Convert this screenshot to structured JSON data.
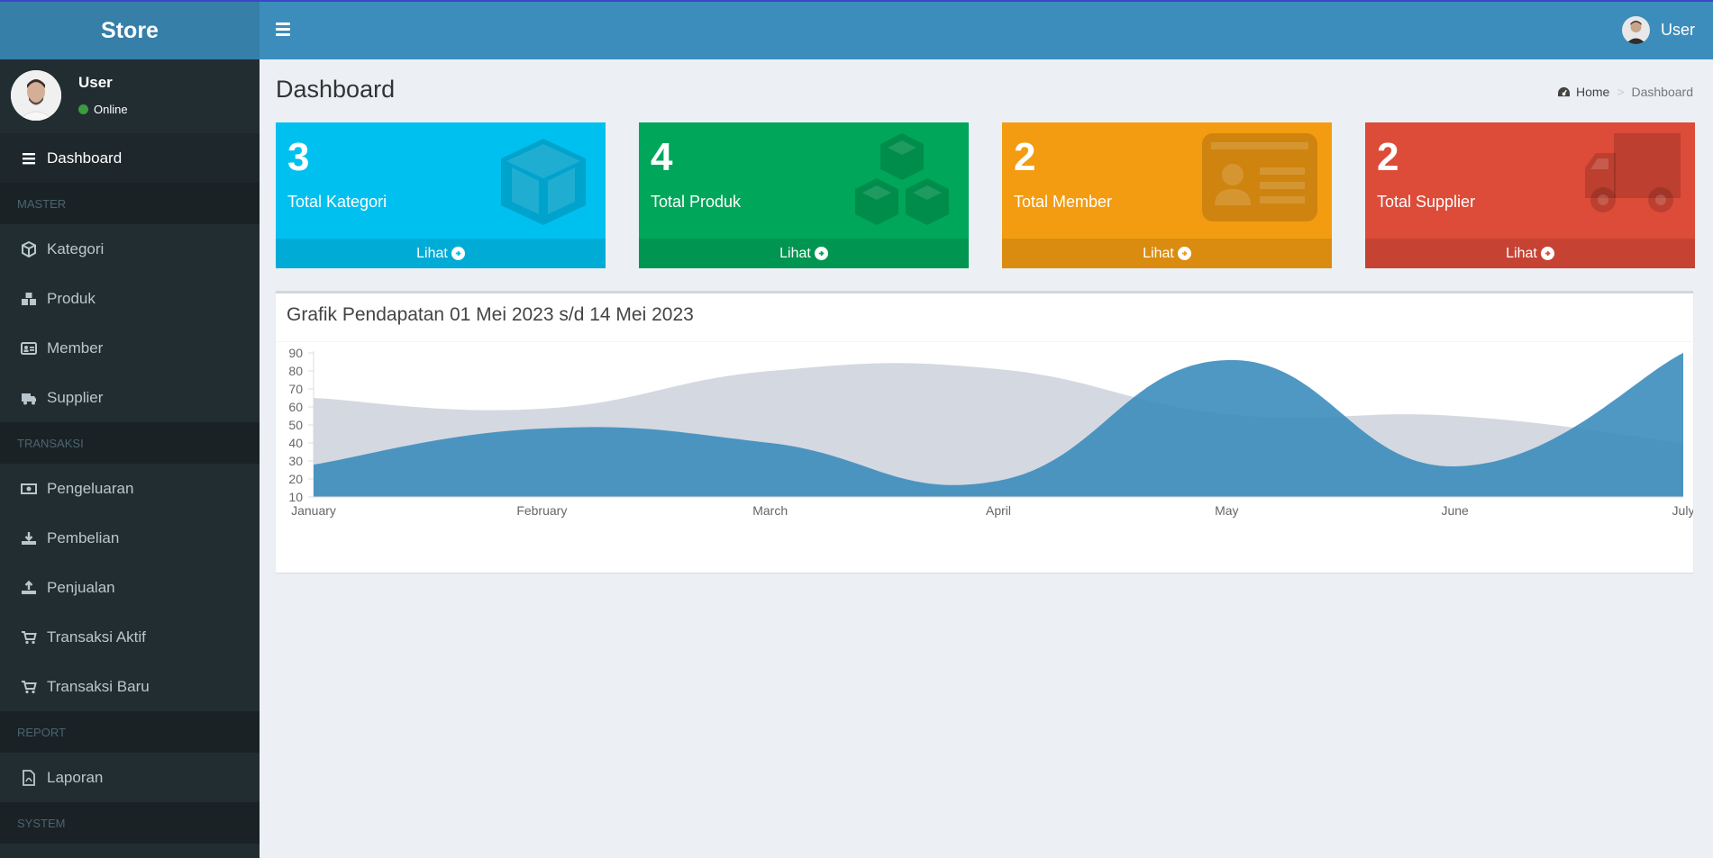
{
  "app": {
    "title": "Store"
  },
  "header": {
    "user_name": "User"
  },
  "sidebar": {
    "user": {
      "name": "User",
      "status": "Online"
    },
    "items": [
      {
        "type": "item",
        "label": "Dashboard",
        "icon": "bars-icon",
        "active": true
      },
      {
        "type": "header",
        "label": "MASTER"
      },
      {
        "type": "item",
        "label": "Kategori",
        "icon": "cube-icon"
      },
      {
        "type": "item",
        "label": "Produk",
        "icon": "cubes-icon"
      },
      {
        "type": "item",
        "label": "Member",
        "icon": "id-card-icon"
      },
      {
        "type": "item",
        "label": "Supplier",
        "icon": "truck-icon"
      },
      {
        "type": "header",
        "label": "TRANSAKSI"
      },
      {
        "type": "item",
        "label": "Pengeluaran",
        "icon": "money-icon"
      },
      {
        "type": "item",
        "label": "Pembelian",
        "icon": "download-icon"
      },
      {
        "type": "item",
        "label": "Penjualan",
        "icon": "upload-icon"
      },
      {
        "type": "item",
        "label": "Transaksi Aktif",
        "icon": "cart-icon"
      },
      {
        "type": "item",
        "label": "Transaksi Baru",
        "icon": "cart-icon"
      },
      {
        "type": "header",
        "label": "REPORT"
      },
      {
        "type": "item",
        "label": "Laporan",
        "icon": "file-pdf-icon"
      },
      {
        "type": "header",
        "label": "SYSTEM"
      }
    ]
  },
  "page": {
    "title": "Dashboard",
    "breadcrumb": {
      "home": "Home",
      "current": "Dashboard"
    }
  },
  "stats": [
    {
      "value": "3",
      "label": "Total Kategori",
      "link": "Lihat",
      "color": "#00c0ef",
      "icon": "cube-icon"
    },
    {
      "value": "4",
      "label": "Total Produk",
      "link": "Lihat",
      "color": "#00a65a",
      "icon": "cubes-icon"
    },
    {
      "value": "2",
      "label": "Total Member",
      "link": "Lihat",
      "color": "#f39c12",
      "icon": "id-card-icon"
    },
    {
      "value": "2",
      "label": "Total Supplier",
      "link": "Lihat",
      "color": "#dd4b39",
      "icon": "truck-icon"
    }
  ],
  "chart": {
    "title": "Grafik Pendapatan 01 Mei 2023 s/d 14 Mei 2023"
  },
  "chart_data": {
    "type": "area",
    "categories": [
      "January",
      "February",
      "March",
      "April",
      "May",
      "June",
      "July"
    ],
    "ylim": [
      10,
      90
    ],
    "yticks": [
      10,
      20,
      30,
      40,
      50,
      60,
      70,
      80,
      90
    ],
    "series": [
      {
        "values": [
          65,
          59,
          80,
          81,
          56,
          55,
          40
        ],
        "color": "#d2d6de"
      },
      {
        "values": [
          28,
          48,
          40,
          19,
          86,
          27,
          90
        ],
        "color": "#3c8dbc"
      }
    ]
  }
}
